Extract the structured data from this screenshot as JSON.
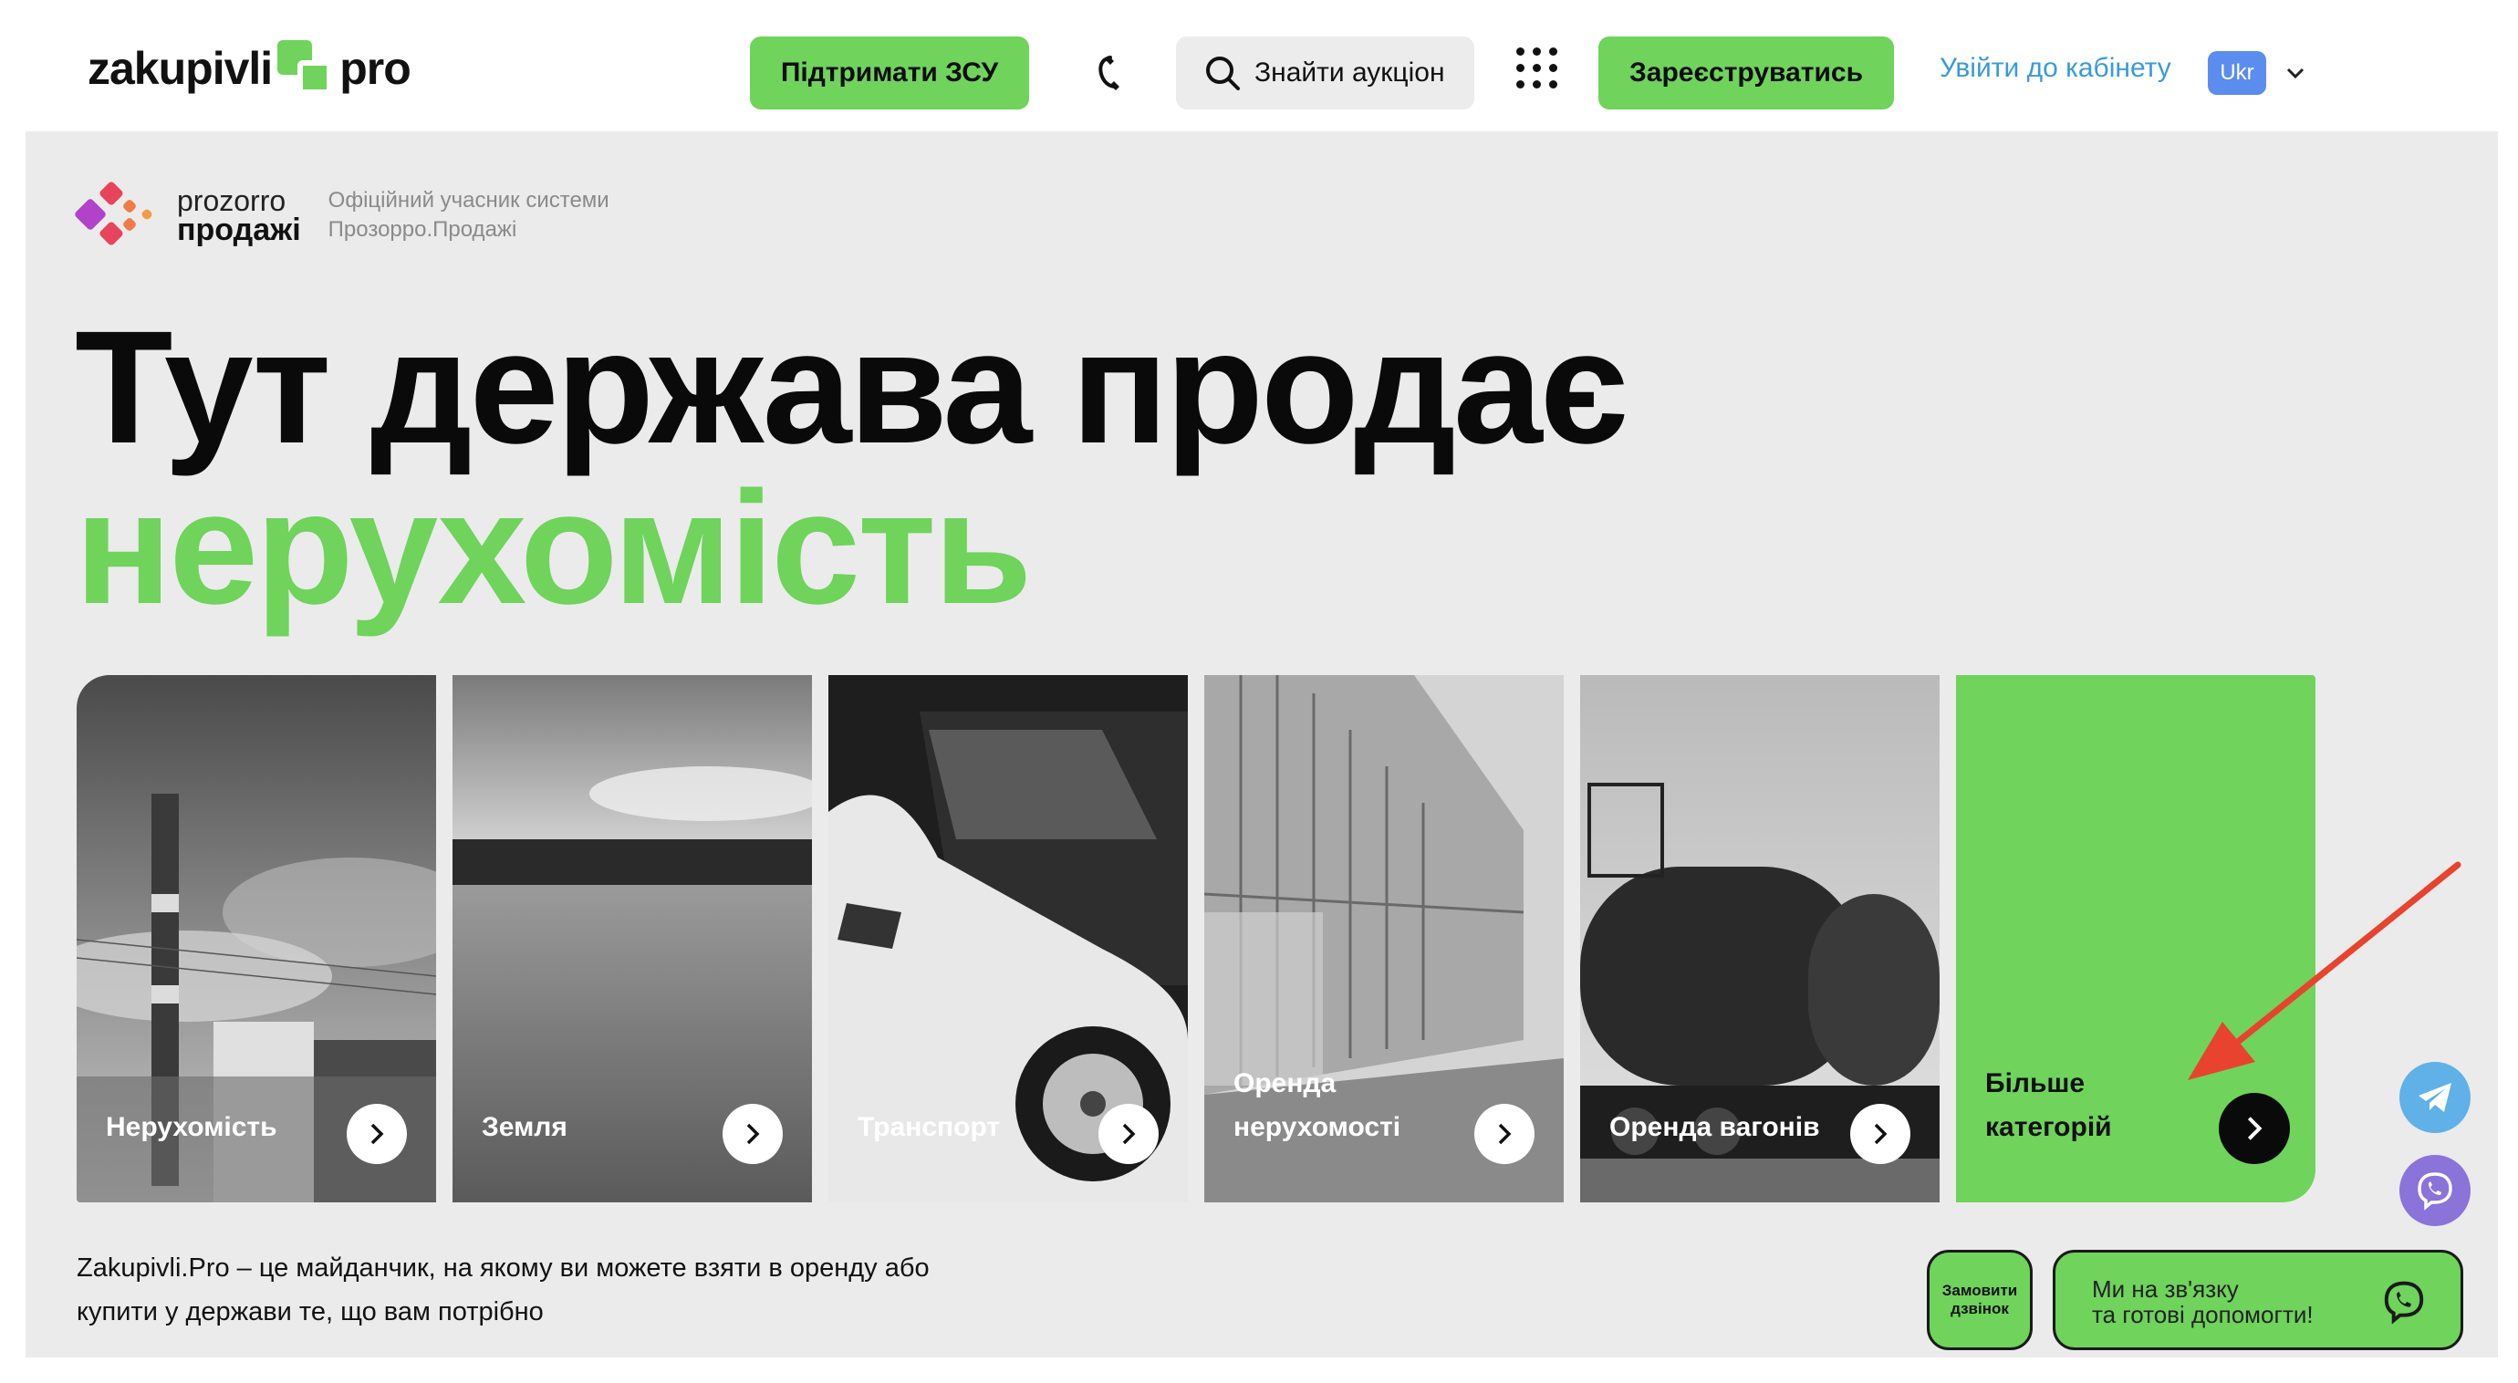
{
  "header": {
    "logo_left": "zakupivli",
    "logo_right": "pro",
    "support_button": "Підтримати ЗСУ",
    "search_button": "Знайти аукціон",
    "register_button": "Зареєструватись",
    "login_link": "Увійти до кабінету",
    "language": "Ukr"
  },
  "prozorro": {
    "name_line1": "prozorro",
    "name_line2": "продажі",
    "desc_line1": "Офіційний учасник системи",
    "desc_line2": "Прозорро.Продажі"
  },
  "hero": {
    "title_line1": "Тут держава продає",
    "title_line2": "нерухомість"
  },
  "categories": [
    {
      "label": "Нерухомість"
    },
    {
      "label": "Земля"
    },
    {
      "label": "Транспорт"
    },
    {
      "label_line1": "Оренда",
      "label_line2": "нерухомості"
    },
    {
      "label": "Оренда вагонів"
    },
    {
      "label_line1": "Більше",
      "label_line2": "категорій"
    }
  ],
  "description": {
    "line1": "Zakupivli.Pro – це майданчик, на якому ви можете взяти в оренду або",
    "line2": "купити у держави те, що вам потрібно"
  },
  "widgets": {
    "callback_line1": "Замовити",
    "callback_line2": "дзвінок",
    "contact_line1": "Ми на зв'язку",
    "contact_line2": "та готові допомогти!"
  },
  "colors": {
    "accent_green": "#6fd35c",
    "link_blue": "#3a9ad9",
    "annotation_red": "#e8432e"
  }
}
